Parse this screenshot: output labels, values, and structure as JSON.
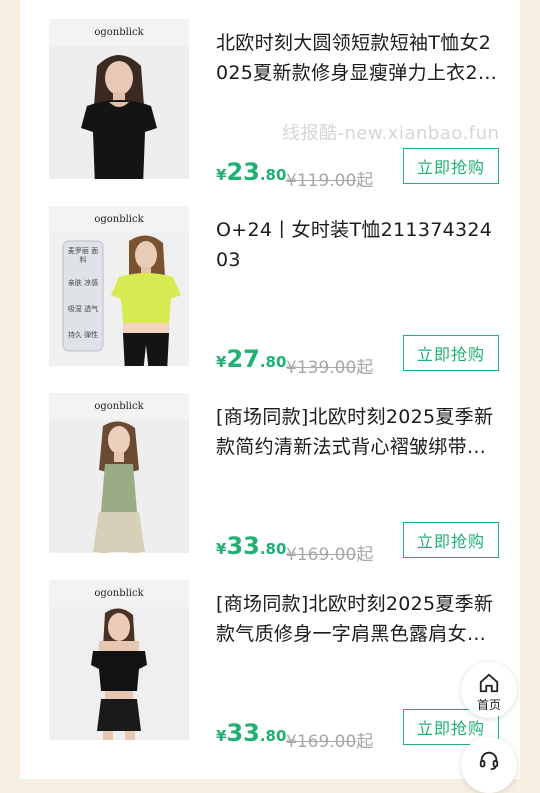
{
  "watermark": "线报酷-new.xianbao.fun",
  "products": [
    {
      "brand": "ogonblick",
      "title": "北欧时刻大圆领短款短袖T恤女2025夏新款修身显瘦弹力上衣2…",
      "price_symbol": "¥",
      "price_int": "23",
      "price_dec": ".80",
      "orig_price": "¥119.00",
      "orig_suffix": "起",
      "buy_label": "立即抢购",
      "thumb_icon": "black-tshirt-model-photo"
    },
    {
      "brand": "ogonblick",
      "title": "O+24丨女时装T恤21137432403",
      "price_symbol": "¥",
      "price_int": "27",
      "price_dec": ".80",
      "orig_price": "¥139.00",
      "orig_suffix": "起",
      "buy_label": "立即抢购",
      "thumb_icon": "lime-tshirt-model-photo",
      "features": [
        "麦罗丽 面料",
        "亲肤 凉感",
        "吸湿 透气",
        "持久 弹性"
      ]
    },
    {
      "brand": "ogonblick",
      "title": "[商场同款]北欧时刻2025夏季新款简约清新法式背心褶皱绑带…",
      "price_symbol": "¥",
      "price_int": "33",
      "price_dec": ".80",
      "orig_price": "¥169.00",
      "orig_suffix": "起",
      "buy_label": "立即抢购",
      "thumb_icon": "green-vest-model-photo"
    },
    {
      "brand": "ogonblick",
      "title": "[商场同款]北欧时刻2025夏季新款气质修身一字肩黑色露肩女…",
      "price_symbol": "¥",
      "price_int": "33",
      "price_dec": ".80",
      "orig_price": "¥169.00",
      "orig_suffix": "起",
      "buy_label": "立即抢购",
      "thumb_icon": "black-offshoulder-model-photo"
    }
  ],
  "float_nav": {
    "home_label": "首页",
    "home_icon": "home-icon",
    "service_icon": "headset-icon"
  }
}
